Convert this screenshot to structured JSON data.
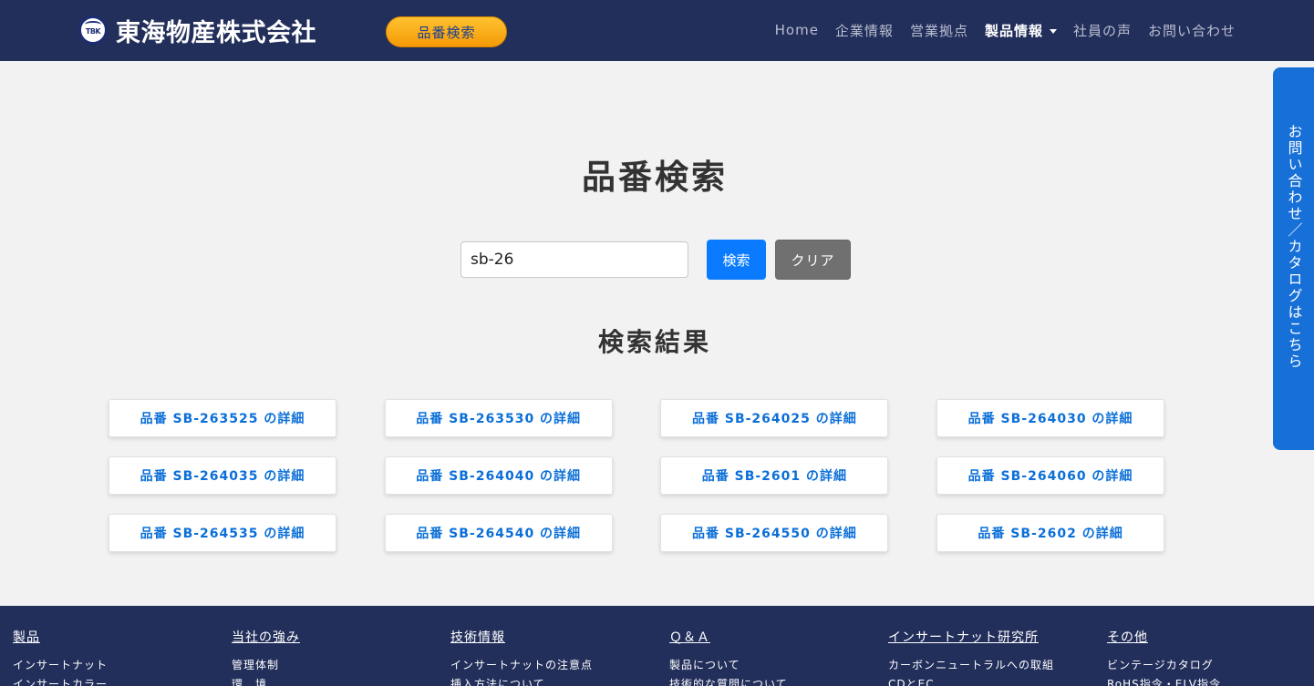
{
  "header": {
    "brand_logo_text": "TBK",
    "brand_name": "東海物産株式会社",
    "search_pill": "品番検索",
    "nav": [
      {
        "label": "Home"
      },
      {
        "label": "企業情報"
      },
      {
        "label": "営業拠点"
      },
      {
        "label": "製品情報"
      },
      {
        "label": "社員の声"
      },
      {
        "label": "お問い合わせ"
      }
    ]
  },
  "side_tab": {
    "label": "お問い合わせ／カタログはこちら"
  },
  "main": {
    "title": "品番検索",
    "search_value": "sb-26",
    "search_button": "検索",
    "clear_button": "クリア",
    "results_title": "検索結果",
    "results": [
      "品番 SB-263525 の詳細",
      "品番 SB-263530 の詳細",
      "品番 SB-264025 の詳細",
      "品番 SB-264030 の詳細",
      "品番 SB-264035 の詳細",
      "品番 SB-264040 の詳細",
      "品番 SB-2601 の詳細",
      "品番 SB-264060 の詳細",
      "品番 SB-264535 の詳細",
      "品番 SB-264540 の詳細",
      "品番 SB-264550 の詳細",
      "品番 SB-2602 の詳細"
    ]
  },
  "footer": {
    "columns": [
      {
        "heading": "製品",
        "links": [
          "インサートナット",
          "インサートカラー"
        ]
      },
      {
        "heading": "当社の強み",
        "links": [
          "管理体制",
          "環　境"
        ]
      },
      {
        "heading": "技術情報",
        "links": [
          "インサートナットの注意点",
          "挿入方法について"
        ]
      },
      {
        "heading": "Ｑ＆Ａ",
        "links": [
          "製品について",
          "技術的な質問について"
        ]
      },
      {
        "heading": "インサートナット研究所",
        "links": [
          "カーボンニュートラルへの取組",
          "CDとEC"
        ]
      },
      {
        "heading": "その他",
        "links": [
          "ビンテージカタログ",
          "RoHS指令・ELV指令"
        ]
      }
    ]
  }
}
